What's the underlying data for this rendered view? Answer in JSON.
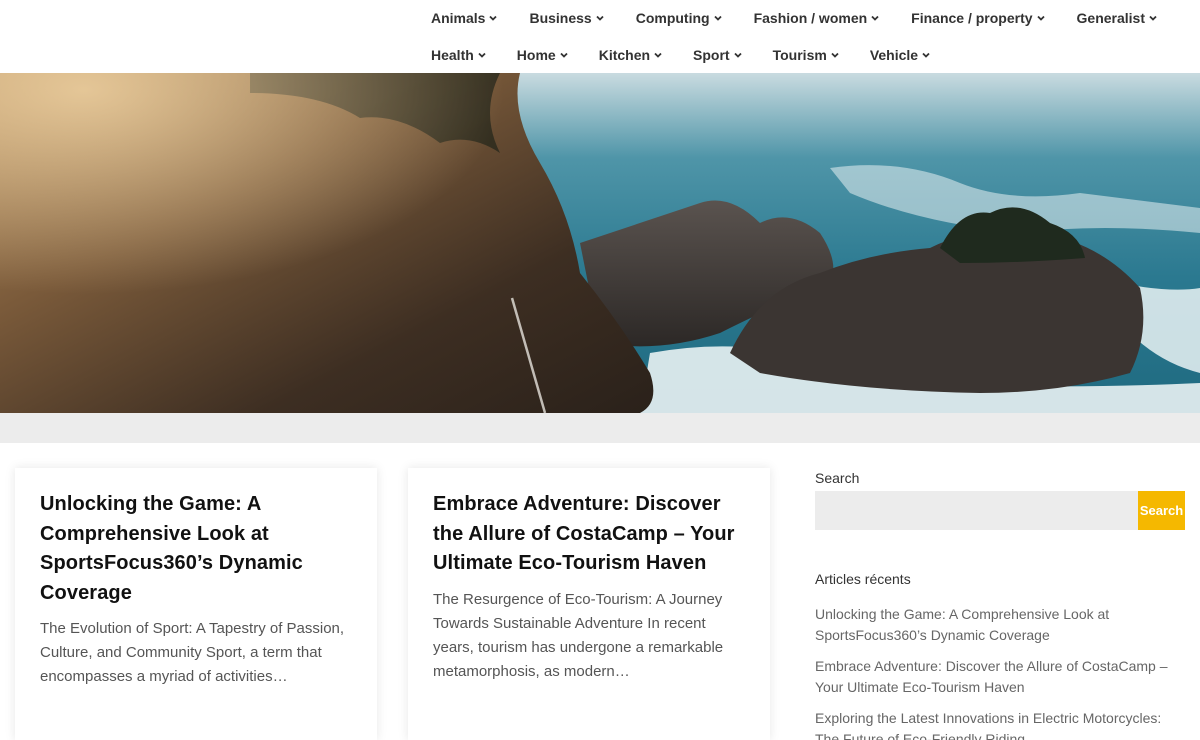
{
  "nav": {
    "row1": [
      "Animals",
      "Business",
      "Computing",
      "Fashion / women",
      "Finance / property",
      "Generalist"
    ],
    "row2": [
      "Health",
      "Home",
      "Kitchen",
      "Sport",
      "Tourism",
      "Vehicle"
    ]
  },
  "posts": [
    {
      "title": "Unlocking the Game: A Comprehensive Look at SportsFocus360’s Dynamic Coverage",
      "excerpt": "The Evolution of Sport: A Tapestry of Passion, Culture, and Community Sport, a term that encompasses a myriad of activities…"
    },
    {
      "title": "Embrace Adventure: Discover the Allure of CostaCamp – Your Ultimate Eco-Tourism Haven",
      "excerpt": "The Resurgence of Eco-Tourism: A Journey Towards Sustainable Adventure In recent years, tourism has undergone a remarkable metamorphosis, as modern…"
    }
  ],
  "sidebar": {
    "search_label": "Search",
    "search_value": "",
    "search_button": "Search",
    "recent_title": "Articles récents",
    "recent": [
      "Unlocking the Game: A Comprehensive Look at SportsFocus360’s Dynamic Coverage",
      "Embrace Adventure: Discover the Allure of CostaCamp – Your Ultimate Eco-Tourism Haven",
      "Exploring the Latest Innovations in Electric Motorcycles: The Future of Eco-Friendly Riding"
    ]
  },
  "colors": {
    "accent": "#f5b800",
    "band": "#ececec",
    "text": "#222222",
    "muted": "#666666"
  },
  "icons": {
    "nav_dropdown": "chevron-down-icon"
  }
}
